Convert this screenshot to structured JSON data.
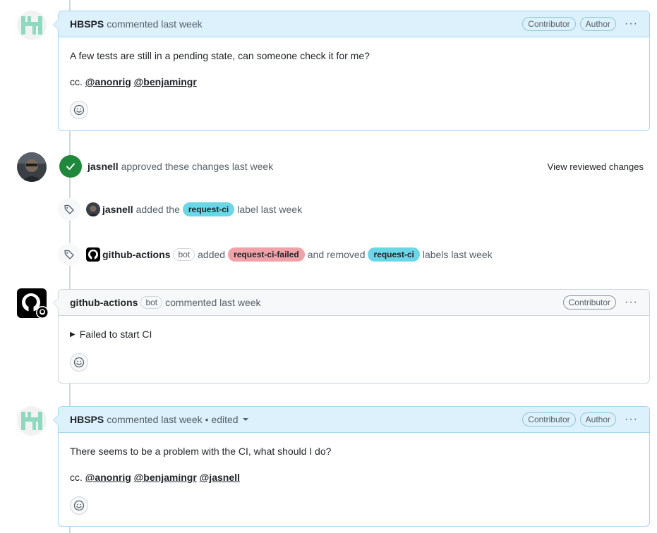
{
  "colors": {
    "author_header_bg": "#dcf1fb",
    "approved_green": "#1f883d",
    "label_request_ci": "#6bd6e6",
    "label_request_ci_failed": "#f0a2a8"
  },
  "comments": [
    {
      "author": "HBSPS",
      "meta": "commented last week",
      "badges": [
        "Contributor",
        "Author"
      ],
      "body": "A few tests are still in a pending state, can someone check it for me?",
      "cc_prefix": "cc.",
      "mentions": [
        "@anonrig",
        "@benjamingr"
      ]
    },
    {
      "author": "github-actions",
      "bot_badge": "bot",
      "meta": "commented last week",
      "badges": [
        "Contributor"
      ],
      "summary": "Failed to start CI"
    },
    {
      "author": "HBSPS",
      "meta": "commented last week",
      "edited": "• edited",
      "badges": [
        "Contributor",
        "Author"
      ],
      "body": "There seems to be a problem with the CI, what should I do?",
      "cc_prefix": "cc.",
      "mentions": [
        "@anonrig",
        "@benjamingr",
        "@jasnell"
      ]
    }
  ],
  "review": {
    "actor": "jasnell",
    "text": "approved these changes last week",
    "view_link": "View reviewed changes"
  },
  "events": [
    {
      "actor": "jasnell",
      "pre": "added the",
      "label": "request-ci",
      "post": "label last week"
    },
    {
      "actor": "github-actions",
      "bot_badge": "bot",
      "pre": "added",
      "label_added": "request-ci-failed",
      "mid": "and removed",
      "label_removed": "request-ci",
      "post": "labels last week"
    }
  ],
  "icons": {
    "tag": "tag-icon",
    "check": "check-icon",
    "smiley": "smiley-icon",
    "kebab": "kebab-horizontal-icon",
    "github": "github-mark-icon"
  },
  "kebab_glyph": "···",
  "triangle_glyph": "▶"
}
